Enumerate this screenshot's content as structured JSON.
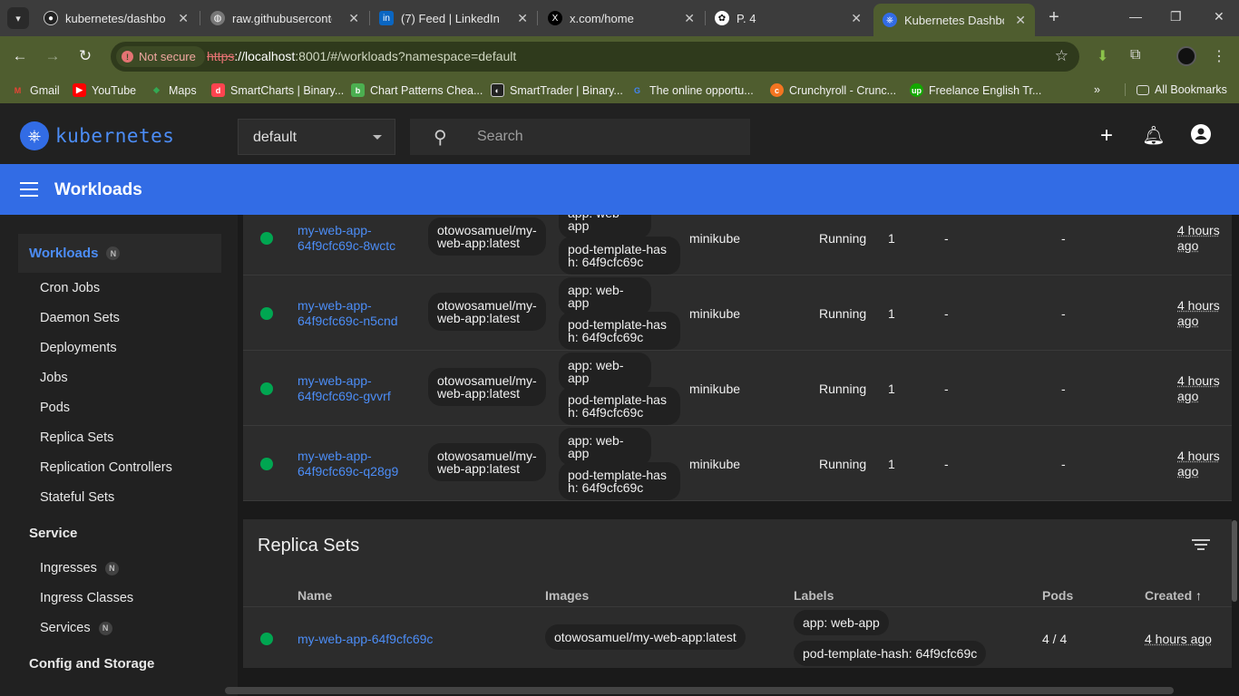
{
  "browser": {
    "tabs": [
      {
        "title": "kubernetes/dashboard",
        "icon": "github-icon"
      },
      {
        "title": "raw.githubusercontent",
        "icon": "globe-icon"
      },
      {
        "title": "(7) Feed | LinkedIn",
        "icon": "linkedin-icon"
      },
      {
        "title": "x.com/home",
        "icon": "x-icon"
      },
      {
        "title": "P. 4",
        "icon": "openai-icon"
      },
      {
        "title": "Kubernetes Dashboard",
        "icon": "kubernetes-icon"
      }
    ],
    "security_label": "Not secure",
    "url_proto": "https",
    "url_host": "://localhost",
    "url_rest": ":8001/#/workloads?namespace=default",
    "bookmarks": [
      "Gmail",
      "YouTube",
      "Maps",
      "SmartCharts | Binary...",
      "Chart Patterns Chea...",
      "SmartTrader | Binary...",
      "The online opportu...",
      "Crunchyroll - Crunc...",
      "Freelance English Tr..."
    ],
    "all_bookmarks": "All Bookmarks"
  },
  "app": {
    "logo_text": "kubernetes",
    "namespace": "default",
    "search_placeholder": "Search",
    "section_title": "Workloads"
  },
  "sidebar": {
    "workloads": "Workloads",
    "badge": "N",
    "workload_items": [
      "Cron Jobs",
      "Daemon Sets",
      "Deployments",
      "Jobs",
      "Pods",
      "Replica Sets",
      "Replication Controllers",
      "Stateful Sets"
    ],
    "service": "Service",
    "service_items": [
      "Ingresses",
      "Ingress Classes",
      "Services"
    ],
    "config": "Config and Storage"
  },
  "pods": [
    {
      "name_a": "my-web-app-",
      "name_b": "64f9cfc69c-8wctc",
      "image_a": "otowosamuel/my-",
      "image_b": "web-app:latest",
      "label_app": "app: web-app",
      "label_hash_a": "pod-template-has",
      "label_hash_b": "h: 64f9cfc69c",
      "node": "minikube",
      "status": "Running",
      "restarts": "1",
      "cpu": "-",
      "mem": "-",
      "created_a": "4 hours",
      "created_b": "ago"
    },
    {
      "name_a": "my-web-app-",
      "name_b": "64f9cfc69c-n5cnd",
      "image_a": "otowosamuel/my-",
      "image_b": "web-app:latest",
      "label_app": "app: web-app",
      "label_hash_a": "pod-template-has",
      "label_hash_b": "h: 64f9cfc69c",
      "node": "minikube",
      "status": "Running",
      "restarts": "1",
      "cpu": "-",
      "mem": "-",
      "created_a": "4 hours",
      "created_b": "ago"
    },
    {
      "name_a": "my-web-app-",
      "name_b": "64f9cfc69c-gvvrf",
      "image_a": "otowosamuel/my-",
      "image_b": "web-app:latest",
      "label_app": "app: web-app",
      "label_hash_a": "pod-template-has",
      "label_hash_b": "h: 64f9cfc69c",
      "node": "minikube",
      "status": "Running",
      "restarts": "1",
      "cpu": "-",
      "mem": "-",
      "created_a": "4 hours",
      "created_b": "ago"
    },
    {
      "name_a": "my-web-app-",
      "name_b": "64f9cfc69c-q28g9",
      "image_a": "otowosamuel/my-",
      "image_b": "web-app:latest",
      "label_app": "app: web-app",
      "label_hash_a": "pod-template-has",
      "label_hash_b": "h: 64f9cfc69c",
      "node": "minikube",
      "status": "Running",
      "restarts": "1",
      "cpu": "-",
      "mem": "-",
      "created_a": "4 hours",
      "created_b": "ago"
    }
  ],
  "replica_sets": {
    "title": "Replica Sets",
    "columns": [
      "Name",
      "Images",
      "Labels",
      "Pods",
      "Created"
    ],
    "sort_arrow": "↑",
    "rows": [
      {
        "name": "my-web-app-64f9cfc69c",
        "image": "otowosamuel/my-web-app:latest",
        "label_app": "app: web-app",
        "label_hash": "pod-template-hash: 64f9cfc69c",
        "pods": "4 / 4",
        "created": "4 hours ago"
      }
    ]
  },
  "colors": {
    "accent": "#326ce5",
    "link": "#4c8df6",
    "running": "#00a651"
  }
}
